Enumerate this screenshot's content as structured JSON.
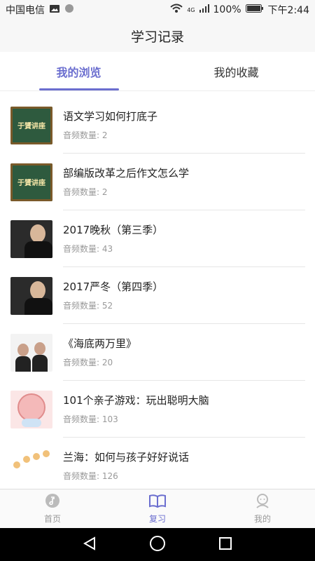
{
  "status": {
    "carrier": "中国电信",
    "battery": "100%",
    "time": "下午2:44",
    "network": "4G"
  },
  "header": {
    "title": "学习记录"
  },
  "tabs": [
    {
      "label": "我的浏览",
      "active": true
    },
    {
      "label": "我的收藏",
      "active": false
    }
  ],
  "items": [
    {
      "title": "语文学习如何打底子",
      "count": "音频数量: 2",
      "thumb": "board",
      "thumb_text": "于贇讲座"
    },
    {
      "title": "部编版改革之后作文怎么学",
      "count": "音频数量: 2",
      "thumb": "board",
      "thumb_text": "于贇讲座"
    },
    {
      "title": "2017晚秋（第三季）",
      "count": "音频数量: 43",
      "thumb": "photo"
    },
    {
      "title": "2017严冬（第四季）",
      "count": "音频数量: 52",
      "thumb": "photo"
    },
    {
      "title": "《海底两万里》",
      "count": "音频数量: 20",
      "thumb": "couple"
    },
    {
      "title": "101个亲子游戏：玩出聪明大脑",
      "count": "音频数量: 103",
      "thumb": "brain"
    },
    {
      "title": "兰海：如何与孩子好好说话",
      "count": "音频数量: 126",
      "thumb": "kids"
    }
  ],
  "bottom_nav": [
    {
      "label": "首页",
      "icon": "home-note-icon",
      "active": false
    },
    {
      "label": "复习",
      "icon": "book-icon",
      "active": true
    },
    {
      "label": "我的",
      "icon": "profile-icon",
      "active": false
    }
  ],
  "colors": {
    "accent": "#6b6ecf",
    "muted": "#999999"
  }
}
